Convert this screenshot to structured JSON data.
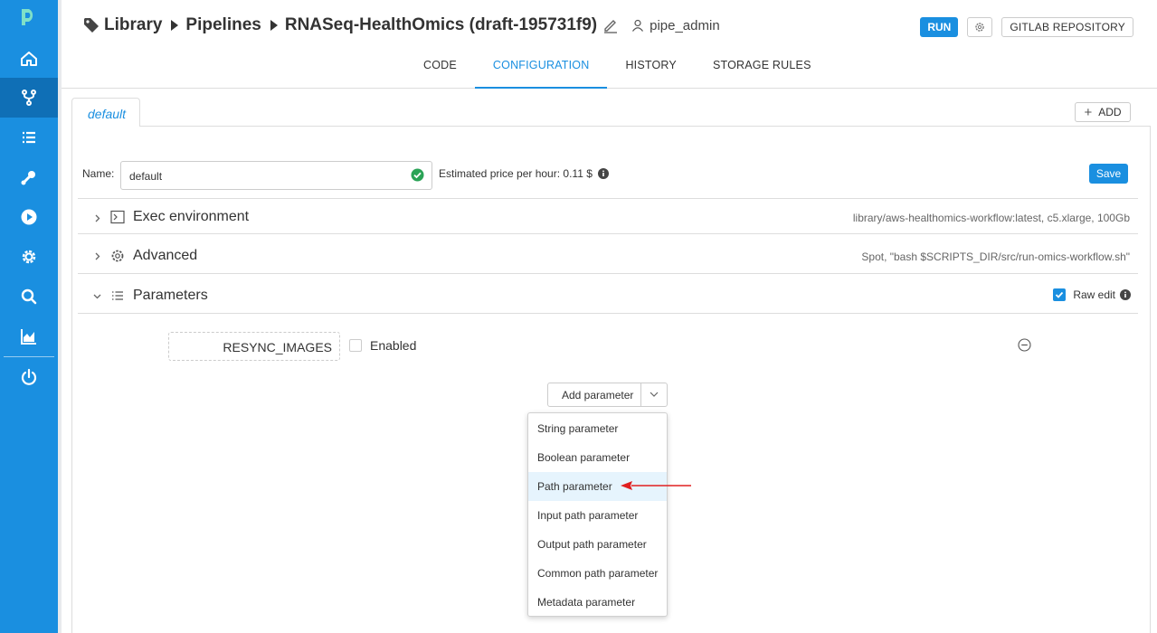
{
  "sidebar": {
    "accent": "#1a8fe0",
    "items": [
      {
        "name": "home-icon"
      },
      {
        "name": "pipelines-icon",
        "active": true
      },
      {
        "name": "runs-list-icon"
      },
      {
        "name": "tools-icon"
      },
      {
        "name": "run-play-icon"
      },
      {
        "name": "settings-icon"
      },
      {
        "name": "search-icon"
      },
      {
        "name": "billing-chart-icon"
      },
      {
        "name": "logout-power-icon"
      }
    ]
  },
  "header": {
    "breadcrumb": [
      "Library",
      "Pipelines",
      "RNASeq-HealthOmics (draft-195731f9)"
    ],
    "owner": "pipe_admin",
    "run_label": "RUN",
    "gitlab_label": "GITLAB REPOSITORY",
    "tabs": [
      {
        "label": "CODE"
      },
      {
        "label": "CONFIGURATION",
        "active": true
      },
      {
        "label": "HISTORY"
      },
      {
        "label": "STORAGE RULES"
      }
    ]
  },
  "config": {
    "tab_label": "default",
    "add_label": "ADD",
    "name_label": "Name:",
    "name_value": "default",
    "price_label": "Estimated price per hour:",
    "price_value": "0.11 $",
    "save_label": "Save",
    "sections": {
      "exec": {
        "title": "Exec environment",
        "summary": "library/aws-healthomics-workflow:latest,  c5.xlarge,  100Gb"
      },
      "advanced": {
        "title": "Advanced",
        "summary": "Spot,  \"bash $SCRIPTS_DIR/src/run-omics-workflow.sh\""
      },
      "parameters": {
        "title": "Parameters",
        "raw_edit_label": "Raw edit",
        "raw_edit_checked": true
      }
    },
    "parameter": {
      "name": "RESYNC_IMAGES",
      "enabled_label": "Enabled"
    },
    "add_parameter_label": "Add parameter",
    "add_parameter_menu": [
      "String parameter",
      "Boolean parameter",
      "Path parameter",
      "Input path parameter",
      "Output path parameter",
      "Common path parameter",
      "Metadata parameter"
    ],
    "highlighted_menu_item": "Path parameter"
  }
}
